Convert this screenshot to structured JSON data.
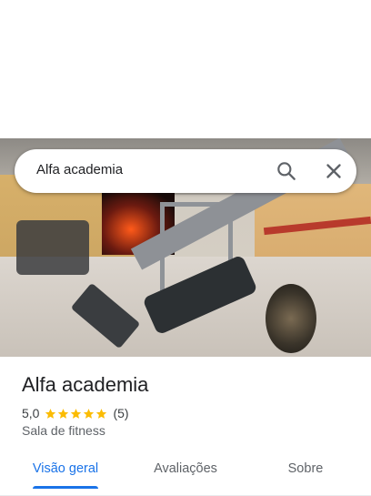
{
  "search": {
    "query": "Alfa academia",
    "search_icon": "search-icon",
    "close_icon": "close-icon"
  },
  "place": {
    "name": "Alfa academia",
    "rating": "5,0",
    "stars": 5,
    "review_count": "(5)",
    "category": "Sala de fitness"
  },
  "tabs": [
    {
      "label": "Visão geral",
      "active": true
    },
    {
      "label": "Avaliações",
      "active": false
    },
    {
      "label": "Sobre",
      "active": false
    }
  ],
  "colors": {
    "accent": "#1a73e8",
    "star": "#fbbc04",
    "text": "#202124",
    "secondary_text": "#5f6368"
  }
}
